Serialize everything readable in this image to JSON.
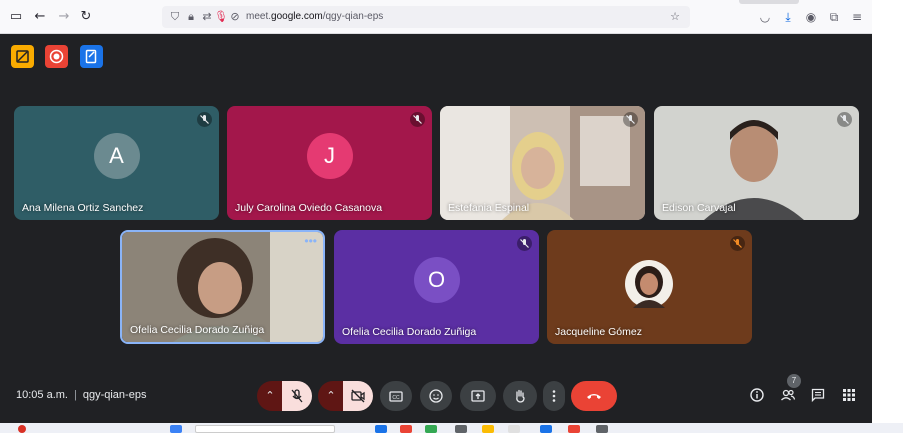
{
  "browser": {
    "url_prefix": "meet.",
    "url_domain": "google.com",
    "url_path": "/qgy-qian-eps"
  },
  "host_controls": [
    {
      "name": "host-controls-icon",
      "color": "#f9ab00"
    },
    {
      "name": "record-icon",
      "color": "#ea4335"
    },
    {
      "name": "notes-icon",
      "color": "#1a73e8"
    }
  ],
  "participants": [
    {
      "name": "Ana Milena Ortiz Sanchez",
      "initial": "A",
      "bg": "#2f5d66",
      "avatar": "#6b8a90",
      "muted": true
    },
    {
      "name": "July Carolina Oviedo Casanova",
      "initial": "J",
      "bg": "#a3174b",
      "avatar": "#e53a72",
      "muted": true
    },
    {
      "name": "Estefania Espinal",
      "initial": "",
      "bg": "#b9a79a",
      "avatar": "",
      "muted": true
    },
    {
      "name": "Edison Carvajal",
      "initial": "",
      "bg": "#c6c6c2",
      "avatar": "",
      "muted": true
    },
    {
      "name": "Ofelia Cecilia Dorado Zuñiga",
      "initial": "",
      "bg": "#7b746b",
      "avatar": "",
      "muted": false
    },
    {
      "name": "Ofelia Cecilia Dorado Zuñiga",
      "initial": "O",
      "bg": "#5b2fa3",
      "avatar": "#7a4fc4",
      "muted": true
    },
    {
      "name": "Jacqueline Gómez",
      "initial": "",
      "bg": "#6e3b1c",
      "avatar": "",
      "muted": true
    }
  ],
  "meeting": {
    "time": "10:05 a.m.",
    "code": "qgy-qian-eps",
    "people_count": "7"
  },
  "colors": {
    "meet_bg": "#202124",
    "control_bg": "#3c4043",
    "danger": "#ea4335"
  }
}
